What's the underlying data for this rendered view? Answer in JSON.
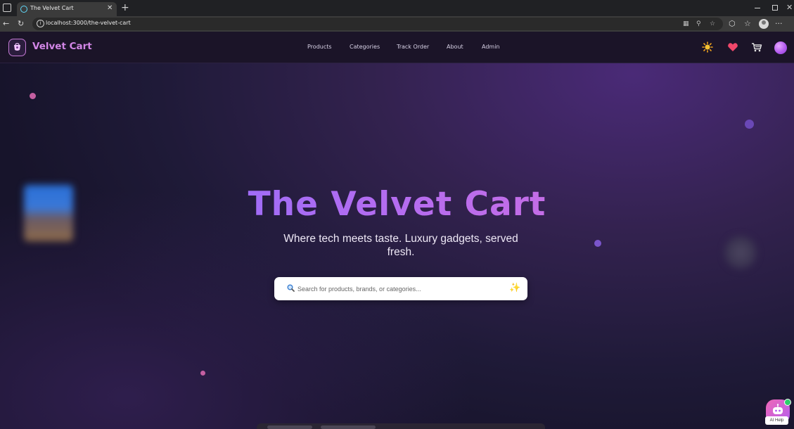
{
  "browser": {
    "tab_title": "The Velvet Cart",
    "tab_close": "✕",
    "new_tab": "+",
    "url": "localhost:3000/the-velvet-cart",
    "icons": [
      "sidebar-toggle-icon",
      "back-icon",
      "reload-icon",
      "info-icon",
      "reading-mode-icon",
      "zoom-icon",
      "favorite-star-icon",
      "extensions-icon",
      "favorites-icon",
      "profile-icon",
      "more-icon"
    ]
  },
  "navbar": {
    "brand": "Velvet Cart",
    "links": [
      "Products",
      "Categories",
      "Track Order",
      "About",
      "Admin"
    ],
    "icons": [
      "theme-sun-icon",
      "wishlist-heart-icon",
      "cart-icon",
      "user-avatar"
    ]
  },
  "hero": {
    "title": "The Velvet Cart",
    "subtitle": "Where tech meets taste. Luxury gadgets, served fresh."
  },
  "search": {
    "placeholder": "Search for products, brands, or categories...",
    "icon": "search-icon",
    "suggest_icon": "sparkle-icon"
  },
  "assistant": {
    "label": "AI Help",
    "status": "online"
  },
  "colors": {
    "brand": "#d286e6",
    "title_gradient_start": "#7d6cff",
    "title_gradient_end": "#de6fd8",
    "background": "#241c3e",
    "online": "#2bd06a"
  }
}
